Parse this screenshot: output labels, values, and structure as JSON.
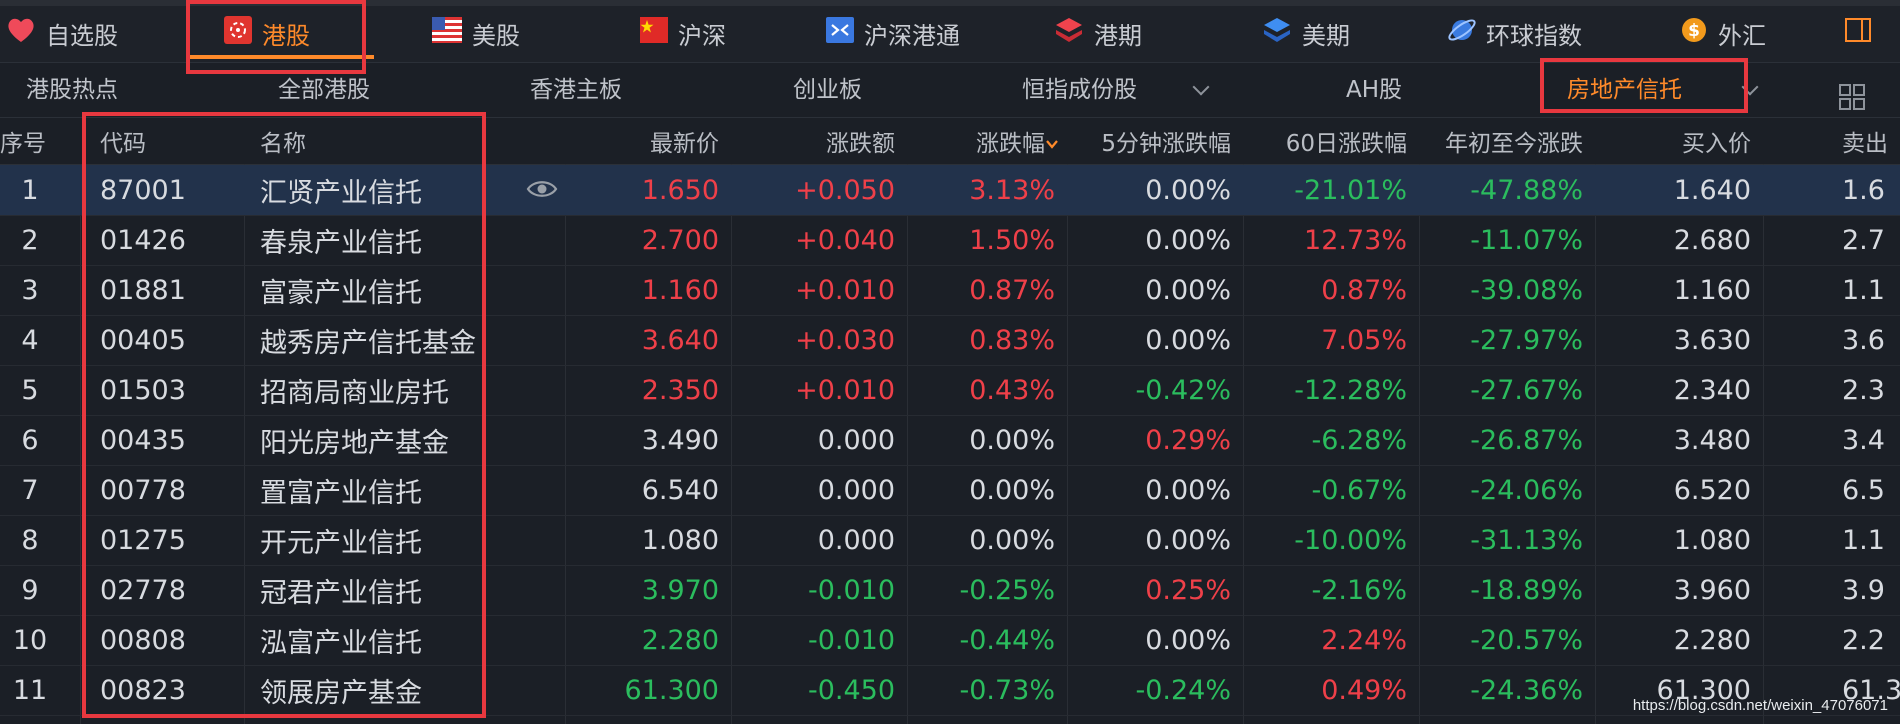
{
  "market_tabs": [
    {
      "label": "自选股",
      "icon": "heart-icon"
    },
    {
      "label": "港股",
      "icon": "hk-flag-icon"
    },
    {
      "label": "美股",
      "icon": "us-flag-icon"
    },
    {
      "label": "沪深",
      "icon": "cn-flag-icon"
    },
    {
      "label": "沪深港通",
      "icon": "connect-icon"
    },
    {
      "label": "港期",
      "icon": "layers-red-icon"
    },
    {
      "label": "美期",
      "icon": "layers-blue-icon"
    },
    {
      "label": "环球指数",
      "icon": "globe-icon"
    },
    {
      "label": "外汇",
      "icon": "dollar-coin-icon"
    }
  ],
  "active_market": "港股",
  "sub_tabs": [
    "港股热点",
    "全部港股",
    "香港主板",
    "创业板",
    "恒指成份股",
    "AH股",
    "房地产信托"
  ],
  "active_sub": "房地产信托",
  "columns": [
    "序号",
    "代码",
    "名称",
    "最新价",
    "涨跌额",
    "涨跌幅",
    "5分钟涨跌幅",
    "60日涨跌幅",
    "年初至今涨跌",
    "买入价",
    "卖出"
  ],
  "sort_column": "涨跌幅",
  "rows": [
    {
      "no": "1",
      "code": "87001",
      "name": "汇贤产业信托",
      "price": "1.650",
      "chg": "+0.050",
      "pct": "3.13%",
      "m5": "0.00%",
      "d60": "-21.01%",
      "ytd": "-47.88%",
      "bid": "1.640",
      "ask": "1.6"
    },
    {
      "no": "2",
      "code": "01426",
      "name": "春泉产业信托",
      "price": "2.700",
      "chg": "+0.040",
      "pct": "1.50%",
      "m5": "0.00%",
      "d60": "12.73%",
      "ytd": "-11.07%",
      "bid": "2.680",
      "ask": "2.7"
    },
    {
      "no": "3",
      "code": "01881",
      "name": "富豪产业信托",
      "price": "1.160",
      "chg": "+0.010",
      "pct": "0.87%",
      "m5": "0.00%",
      "d60": "0.87%",
      "ytd": "-39.08%",
      "bid": "1.160",
      "ask": "1.1"
    },
    {
      "no": "4",
      "code": "00405",
      "name": "越秀房产信托基金",
      "price": "3.640",
      "chg": "+0.030",
      "pct": "0.83%",
      "m5": "0.00%",
      "d60": "7.05%",
      "ytd": "-27.97%",
      "bid": "3.630",
      "ask": "3.6"
    },
    {
      "no": "5",
      "code": "01503",
      "name": "招商局商业房托",
      "price": "2.350",
      "chg": "+0.010",
      "pct": "0.43%",
      "m5": "-0.42%",
      "d60": "-12.28%",
      "ytd": "-27.67%",
      "bid": "2.340",
      "ask": "2.3"
    },
    {
      "no": "6",
      "code": "00435",
      "name": "阳光房地产基金",
      "price": "3.490",
      "chg": "0.000",
      "pct": "0.00%",
      "m5": "0.29%",
      "d60": "-6.28%",
      "ytd": "-26.87%",
      "bid": "3.480",
      "ask": "3.4"
    },
    {
      "no": "7",
      "code": "00778",
      "name": "置富产业信托",
      "price": "6.540",
      "chg": "0.000",
      "pct": "0.00%",
      "m5": "0.00%",
      "d60": "-0.67%",
      "ytd": "-24.06%",
      "bid": "6.520",
      "ask": "6.5"
    },
    {
      "no": "8",
      "code": "01275",
      "name": "开元产业信托",
      "price": "1.080",
      "chg": "0.000",
      "pct": "0.00%",
      "m5": "0.00%",
      "d60": "-10.00%",
      "ytd": "-31.13%",
      "bid": "1.080",
      "ask": "1.1"
    },
    {
      "no": "9",
      "code": "02778",
      "name": "冠君产业信托",
      "price": "3.970",
      "chg": "-0.010",
      "pct": "-0.25%",
      "m5": "0.25%",
      "d60": "-2.16%",
      "ytd": "-18.89%",
      "bid": "3.960",
      "ask": "3.9"
    },
    {
      "no": "10",
      "code": "00808",
      "name": "泓富产业信托",
      "price": "2.280",
      "chg": "-0.010",
      "pct": "-0.44%",
      "m5": "0.00%",
      "d60": "2.24%",
      "ytd": "-20.57%",
      "bid": "2.280",
      "ask": "2.2"
    },
    {
      "no": "11",
      "code": "00823",
      "name": "领展房产基金",
      "price": "61.300",
      "chg": "-0.450",
      "pct": "-0.73%",
      "m5": "-0.24%",
      "d60": "0.49%",
      "ytd": "-24.36%",
      "bid": "61.300",
      "ask": "61.3"
    }
  ],
  "watermark": "https://blog.csdn.net/weixin_47076071",
  "colors": {
    "up": "#ef4049",
    "down": "#2bbd5e",
    "accent": "#ff8a2a",
    "highlight_box": "#e8383f",
    "selected_row": "#22324b"
  }
}
